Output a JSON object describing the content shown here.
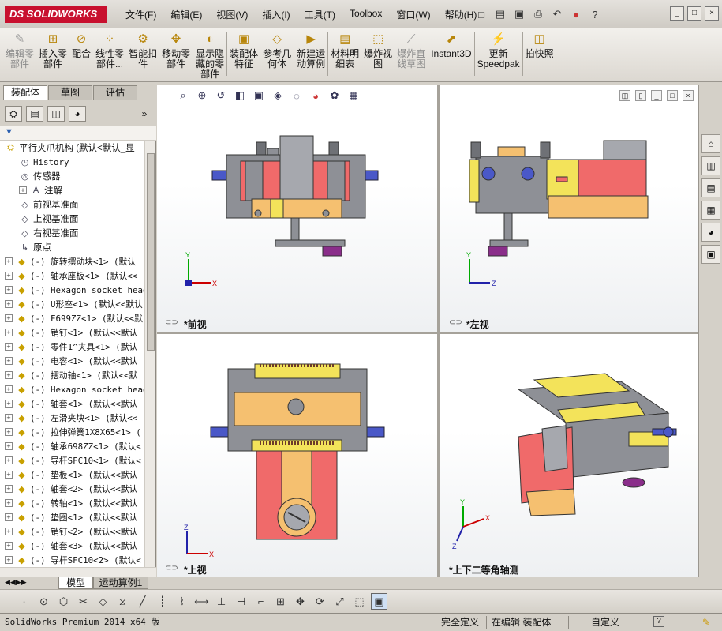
{
  "app": {
    "logo_text": "DS SOLIDWORKS",
    "brand_color": "#c8102e"
  },
  "menu": [
    "文件(F)",
    "编辑(E)",
    "视图(V)",
    "插入(I)",
    "工具(T)",
    "Toolbox",
    "窗口(W)",
    "帮助(H)"
  ],
  "quick_icons": [
    "new-icon",
    "open-icon",
    "save-icon",
    "print-icon",
    "undo-icon",
    "rebuild-icon",
    "help-icon"
  ],
  "window_controls": [
    "_",
    "□",
    "×"
  ],
  "commands": [
    {
      "label": "编辑零\n部件",
      "icon": "edit-part-icon",
      "disabled": true
    },
    {
      "label": "插入零\n部件",
      "icon": "insert-component-icon",
      "disabled": false
    },
    {
      "label": "配合",
      "icon": "mate-icon",
      "disabled": false
    },
    {
      "label": "线性零\n部件...",
      "icon": "linear-pattern-icon",
      "disabled": false
    },
    {
      "label": "智能扣\n件",
      "icon": "smart-fastener-icon",
      "disabled": false
    },
    {
      "label": "移动零\n部件",
      "icon": "move-component-icon",
      "disabled": false
    },
    {
      "label": "显示隐\n藏的零\n部件",
      "icon": "show-hidden-icon",
      "disabled": false
    },
    {
      "label": "装配体\n特征",
      "icon": "assembly-feature-icon",
      "disabled": false
    },
    {
      "label": "参考几\n何体",
      "icon": "reference-geometry-icon",
      "disabled": false
    },
    {
      "label": "新建运\n动算例",
      "icon": "new-motion-study-icon",
      "disabled": false
    },
    {
      "label": "材料明\n细表",
      "icon": "bom-icon",
      "disabled": false
    },
    {
      "label": "爆炸视\n图",
      "icon": "exploded-view-icon",
      "disabled": false
    },
    {
      "label": "爆炸直\n线草图",
      "icon": "explode-line-sketch-icon",
      "disabled": true
    },
    {
      "label": "Instant3D",
      "icon": "instant3d-icon",
      "disabled": false
    },
    {
      "label": "更新\nSpeedpak",
      "icon": "speedpak-icon",
      "disabled": false
    },
    {
      "label": "拍快照",
      "icon": "snapshot-icon",
      "disabled": false
    }
  ],
  "command_tabs": [
    "装配体",
    "草图",
    "评估"
  ],
  "panel_tabs": [
    "feature-manager-icon",
    "property-manager-icon",
    "configuration-manager-icon",
    "display-manager-icon"
  ],
  "tree": [
    {
      "indent": 0,
      "expand": "",
      "icon": "assembly-icon",
      "text": "平行夹爪机构  (默认<默认_显",
      "mono": false
    },
    {
      "indent": 1,
      "expand": "",
      "icon": "history-icon",
      "text": "History",
      "mono": true
    },
    {
      "indent": 1,
      "expand": "",
      "icon": "sensor-icon",
      "text": "传感器",
      "mono": false
    },
    {
      "indent": 1,
      "expand": "+",
      "icon": "annotation-icon",
      "text": "注解",
      "mono": false
    },
    {
      "indent": 1,
      "expand": "",
      "icon": "plane-icon",
      "text": "前视基准面",
      "mono": false
    },
    {
      "indent": 1,
      "expand": "",
      "icon": "plane-icon",
      "text": "上视基准面",
      "mono": false
    },
    {
      "indent": 1,
      "expand": "",
      "icon": "plane-icon",
      "text": "右视基准面",
      "mono": false
    },
    {
      "indent": 1,
      "expand": "",
      "icon": "origin-icon",
      "text": "原点",
      "mono": false
    },
    {
      "indent": 0,
      "expand": "+",
      "icon": "part-icon",
      "text": "(-) 旋转摆动块<1> (默认",
      "mono": true
    },
    {
      "indent": 0,
      "expand": "+",
      "icon": "part-icon",
      "text": "(-) 轴承座板<1> (默认<<",
      "mono": true
    },
    {
      "indent": 0,
      "expand": "+",
      "icon": "part-icon",
      "text": "(-) Hexagon socket head",
      "mono": true
    },
    {
      "indent": 0,
      "expand": "+",
      "icon": "part-icon",
      "text": "(-) U形座<1> (默认<<默认",
      "mono": true
    },
    {
      "indent": 0,
      "expand": "+",
      "icon": "part-icon",
      "text": "(-) F699ZZ<1> (默认<<默",
      "mono": true
    },
    {
      "indent": 0,
      "expand": "+",
      "icon": "part-icon",
      "text": "(-) 销钉<1> (默认<<默认",
      "mono": true
    },
    {
      "indent": 0,
      "expand": "+",
      "icon": "part-icon",
      "text": "(-) 零件1^夹具<1> (默认",
      "mono": true
    },
    {
      "indent": 0,
      "expand": "+",
      "icon": "part-icon",
      "text": "(-) 电容<1> (默认<<默认",
      "mono": true
    },
    {
      "indent": 0,
      "expand": "+",
      "icon": "part-icon",
      "text": "(-) 摆动轴<1> (默认<<默",
      "mono": true
    },
    {
      "indent": 0,
      "expand": "+",
      "icon": "part-icon",
      "text": "(-) Hexagon socket head",
      "mono": true
    },
    {
      "indent": 0,
      "expand": "+",
      "icon": "part-icon",
      "text": "(-) 轴套<1> (默认<<默认",
      "mono": true
    },
    {
      "indent": 0,
      "expand": "+",
      "icon": "part-icon",
      "text": "(-) 左滑夹块<1> (默认<<",
      "mono": true
    },
    {
      "indent": 0,
      "expand": "+",
      "icon": "part-icon",
      "text": "(-) 拉伸弹簧1X8X65<1> (",
      "mono": true
    },
    {
      "indent": 0,
      "expand": "+",
      "icon": "part-icon",
      "text": "(-) 轴承698ZZ<1> (默认<",
      "mono": true
    },
    {
      "indent": 0,
      "expand": "+",
      "icon": "part-icon",
      "text": "(-) 导杆SFC10<1> (默认<",
      "mono": true
    },
    {
      "indent": 0,
      "expand": "+",
      "icon": "part-icon",
      "text": "(-) 垫板<1> (默认<<默认",
      "mono": true
    },
    {
      "indent": 0,
      "expand": "+",
      "icon": "part-icon",
      "text": "(-) 轴套<2> (默认<<默认",
      "mono": true
    },
    {
      "indent": 0,
      "expand": "+",
      "icon": "part-icon",
      "text": "(-) 转轴<1> (默认<<默认",
      "mono": true
    },
    {
      "indent": 0,
      "expand": "+",
      "icon": "part-icon",
      "text": "(-) 垫圈<1> (默认<<默认",
      "mono": true
    },
    {
      "indent": 0,
      "expand": "+",
      "icon": "part-icon",
      "text": "(-) 销钉<2> (默认<<默认",
      "mono": true
    },
    {
      "indent": 0,
      "expand": "+",
      "icon": "part-icon",
      "text": "(-) 轴套<3> (默认<<默认",
      "mono": true
    },
    {
      "indent": 0,
      "expand": "+",
      "icon": "part-icon",
      "text": "(-) 导杆SFC10<2> (默认<",
      "mono": true
    }
  ],
  "viewports": [
    {
      "label": "*前视",
      "axes": [
        "Y",
        "X"
      ]
    },
    {
      "label": "*左视",
      "axes": [
        "Y",
        "Z"
      ]
    },
    {
      "label": "*上视",
      "axes": [
        "Z",
        "X"
      ]
    },
    {
      "label": "*上下二等角轴测",
      "axes": [
        "Y",
        "X",
        "Z"
      ]
    }
  ],
  "bottom_tabs": [
    "模型",
    "运动算例1"
  ],
  "status": {
    "product": "SolidWorks Premium 2014 x64 版",
    "fully_defined": "完全定义",
    "editing": "在编辑 装配体",
    "custom": "自定义"
  },
  "colors": {
    "salmon": "#f06a6a",
    "orange": "#f5c070",
    "yellow": "#f3e35a",
    "grey": "#8e9096",
    "blue": "#4a58c8",
    "purple": "#8a2e8a"
  }
}
